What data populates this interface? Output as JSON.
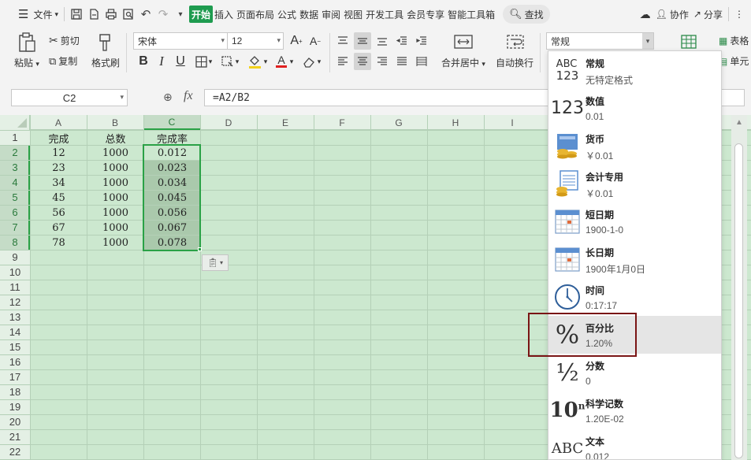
{
  "menu": {
    "file_label": "文件",
    "tabs": [
      {
        "label": "开始",
        "active": true
      },
      {
        "label": "插入",
        "active": false
      },
      {
        "label": "页面布局",
        "active": false
      },
      {
        "label": "公式",
        "active": false
      },
      {
        "label": "数据",
        "active": false
      },
      {
        "label": "审阅",
        "active": false
      },
      {
        "label": "视图",
        "active": false
      },
      {
        "label": "开发工具",
        "active": false
      },
      {
        "label": "会员专享",
        "active": false
      },
      {
        "label": "智能工具箱",
        "active": false
      }
    ],
    "search_label": "查找",
    "collab_label": "协作",
    "share_label": "分享"
  },
  "ribbon": {
    "paste_label": "粘贴",
    "cut_label": "剪切",
    "copy_label": "复制",
    "format_painter_label": "格式刷",
    "font_name": "宋体",
    "font_size": "12",
    "merge_label": "合并居中",
    "wrap_label": "自动换行",
    "number_format": "常规",
    "table_style_label": "表格",
    "cell_label": "单元"
  },
  "formula_bar": {
    "name_box": "C2",
    "formula": "=A2/B2"
  },
  "grid": {
    "columns": [
      "A",
      "B",
      "C",
      "D",
      "E",
      "F",
      "G",
      "H",
      "I"
    ],
    "rows": [
      "1",
      "2",
      "3",
      "4",
      "5",
      "6",
      "7",
      "8",
      "9",
      "10",
      "11",
      "12",
      "13",
      "14",
      "15",
      "16",
      "17",
      "18",
      "19",
      "20",
      "21",
      "22"
    ],
    "header_row": [
      "完成",
      "总数",
      "完成率"
    ],
    "data": [
      [
        "12",
        "1000",
        "0.012"
      ],
      [
        "23",
        "1000",
        "0.023"
      ],
      [
        "34",
        "1000",
        "0.034"
      ],
      [
        "45",
        "1000",
        "0.045"
      ],
      [
        "56",
        "1000",
        "0.056"
      ],
      [
        "67",
        "1000",
        "0.067"
      ],
      [
        "78",
        "1000",
        "0.078"
      ]
    ]
  },
  "format_menu": {
    "items": [
      {
        "name": "常规",
        "sample": "无特定格式",
        "icon": "general-format-icon"
      },
      {
        "name": "数值",
        "sample": "0.01",
        "icon": "number-format-icon"
      },
      {
        "name": "货币",
        "sample": "￥0.01",
        "icon": "currency-icon"
      },
      {
        "name": "会计专用",
        "sample": "￥0.01",
        "icon": "accounting-icon"
      },
      {
        "name": "短日期",
        "sample": "1900-1-0",
        "icon": "short-date-calendar-icon"
      },
      {
        "name": "长日期",
        "sample": "1900年1月0日",
        "icon": "long-date-calendar-icon"
      },
      {
        "name": "时间",
        "sample": "0:17:17",
        "icon": "clock-icon"
      },
      {
        "name": "百分比",
        "sample": "1.20%",
        "icon": "percent-icon"
      },
      {
        "name": "分数",
        "sample": "0",
        "icon": "fraction-icon"
      },
      {
        "name": "科学记数",
        "sample": "1.20E-02",
        "icon": "scientific-icon"
      },
      {
        "name": "文本",
        "sample": "0.012",
        "icon": "text-format-icon"
      }
    ],
    "highlighted": "百分比"
  },
  "colors": {
    "accent_green": "#1e9b4f",
    "grid_bg": "#cce8cf",
    "highlight_box": "#7a1515"
  }
}
